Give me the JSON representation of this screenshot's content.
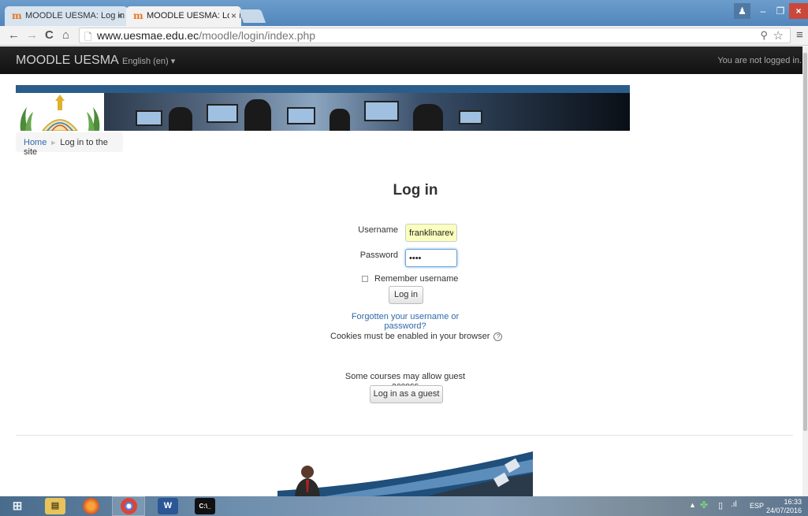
{
  "browser": {
    "tabs": [
      {
        "label": "MOODLE UESMA: Log in t",
        "favicon": "m"
      },
      {
        "label": "MOODLE UESMA: Log in t",
        "favicon": "m"
      }
    ],
    "tab_close": "×",
    "url_host": "www.uesmae.edu.ec",
    "url_path": "/moodle/login/index.php",
    "icons": {
      "back": "←",
      "forward": "→",
      "reload": "C",
      "home": "⌂",
      "page": "🗋",
      "zoom": "⚲",
      "star": "☆",
      "menu": "≡"
    },
    "window_controls": {
      "user": "♟",
      "minimize": "–",
      "maximize": "❐",
      "close": "×"
    }
  },
  "navbar": {
    "brand": "MOODLE UESMA",
    "language": "English (en) ▾",
    "login_info": "You are not logged in."
  },
  "breadcrumb": {
    "home": "Home",
    "separator": "►",
    "current": "Log in to the site"
  },
  "login": {
    "title": "Log in",
    "username_label": "Username",
    "username_value": "franklinareval",
    "password_label": "Password",
    "password_value": "••••",
    "remember_label": "Remember username",
    "login_button": "Log in",
    "forgot_link": "Forgotten your username or password?",
    "cookies_text": "Cookies must be enabled in your browser",
    "help_icon": "?",
    "guest_text": "Some courses may allow guest access",
    "guest_button": "Log in as a guest"
  },
  "taskbar": {
    "start_icon": "⊞",
    "apps": {
      "explorer": "▤",
      "firefox": "",
      "chrome": "",
      "word": "W",
      "cmd": "C:\\_"
    },
    "tray": {
      "up_arrow": "▲",
      "network_icon": "✤",
      "battery_icon": "▯",
      "signal_icon": ".ıl",
      "language": "ESP",
      "time": "16:33",
      "date": "24/07/2016"
    }
  },
  "colors": {
    "titlebar": "#5a8cbf",
    "navbar": "#1c1c1c",
    "link": "#2f6aa8",
    "autofill": "#faffbd",
    "close_button": "#c9483c"
  }
}
